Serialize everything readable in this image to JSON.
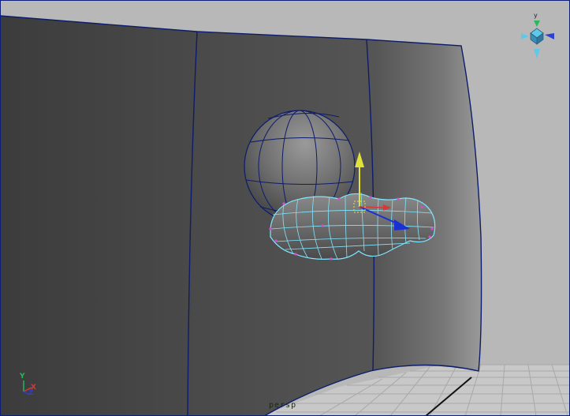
{
  "viewport": {
    "camera_name": "persp",
    "background_color": "#b8b8b8",
    "border_color": "#0b1f7a"
  },
  "view_cube": {
    "top_label": "y",
    "top_axis": "y",
    "x_color": "#d23a3a",
    "y_color": "#2ab85a",
    "z_color": "#2f3fd0"
  },
  "corner_axes": {
    "y_label": "Y",
    "x_label": "X",
    "z_label": "Z",
    "x_color": "#d23a3a",
    "y_color": "#2ab85a",
    "z_color": "#2f3fd0"
  },
  "scene": {
    "wall_color": "#4a4a4a",
    "floor_color": "#c6c6c6",
    "sphere_color": "#6a6a6a",
    "wire_color": "#7fe6ff",
    "vertex_color": "#d64ad6",
    "edge_color": "#0d1c6b",
    "move_handle_y_color": "#e2e23a",
    "move_handle_z_color": "#1a2fd6"
  }
}
